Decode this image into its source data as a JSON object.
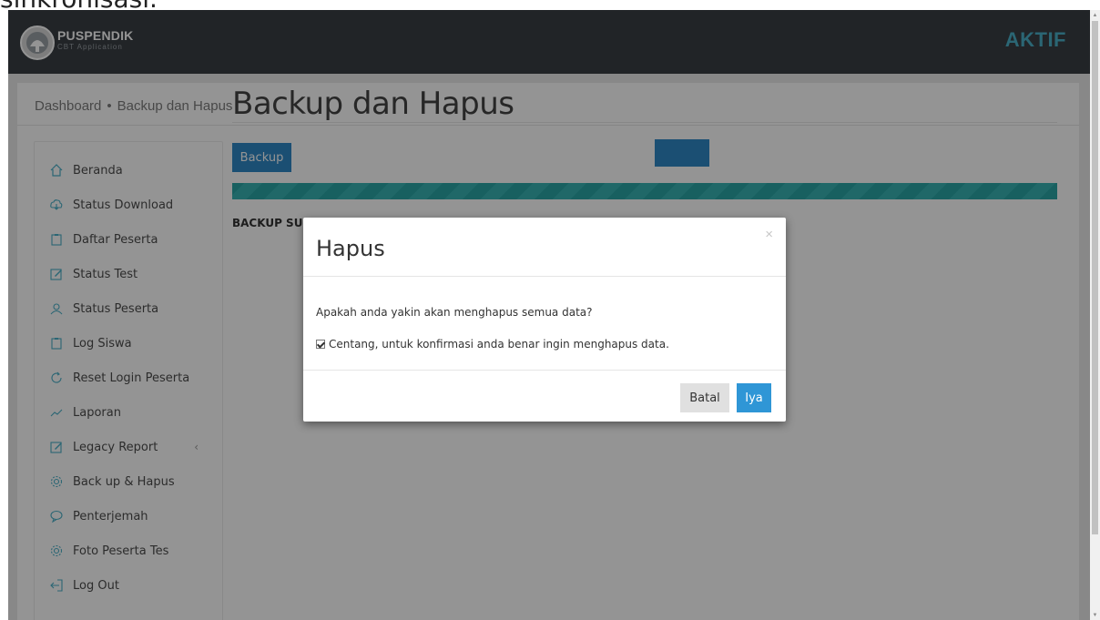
{
  "caption": "sinkronisasi.",
  "header": {
    "brand_title": "PUSPENDIK",
    "brand_subtitle": "CBT Application",
    "status": "AKTIF"
  },
  "breadcrumb": {
    "home": "Dashboard",
    "separator": "•",
    "current": "Backup dan Hapus"
  },
  "sidebar": {
    "items": [
      {
        "label": "Beranda",
        "icon": "home-icon"
      },
      {
        "label": "Status Download",
        "icon": "cloud-download-icon"
      },
      {
        "label": "Daftar Peserta",
        "icon": "clipboard-icon"
      },
      {
        "label": "Status Test",
        "icon": "edit-icon"
      },
      {
        "label": "Status Peserta",
        "icon": "user-icon"
      },
      {
        "label": "Log Siswa",
        "icon": "clipboard-icon"
      },
      {
        "label": "Reset Login Peserta",
        "icon": "refresh-icon"
      },
      {
        "label": "Laporan",
        "icon": "chart-line-icon"
      },
      {
        "label": "Legacy Report",
        "icon": "edit-icon",
        "chevron": "‹"
      },
      {
        "label": "Back up & Hapus",
        "icon": "gear-icon"
      },
      {
        "label": "Penterjemah",
        "icon": "chat-icon"
      },
      {
        "label": "Foto Peserta Tes",
        "icon": "gear-icon"
      },
      {
        "label": "Log Out",
        "icon": "logout-icon"
      }
    ]
  },
  "main": {
    "title": "Backup dan Hapus",
    "backup_button": "Backup",
    "backup_status": "BACKUP SU"
  },
  "modal": {
    "title": "Hapus",
    "close": "×",
    "question": "Apakah anda yakin akan menghapus semua data?",
    "checkbox_label": "Centang, untuk konfirmasi anda benar ingin menghapus data.",
    "checkbox_checked": true,
    "cancel_label": "Batal",
    "confirm_label": "Iya"
  },
  "colors": {
    "navbar": "#3a3f44",
    "accent": "#4ab0c8",
    "primary_button": "#2f88c7",
    "progress": "#2aa5a5"
  }
}
